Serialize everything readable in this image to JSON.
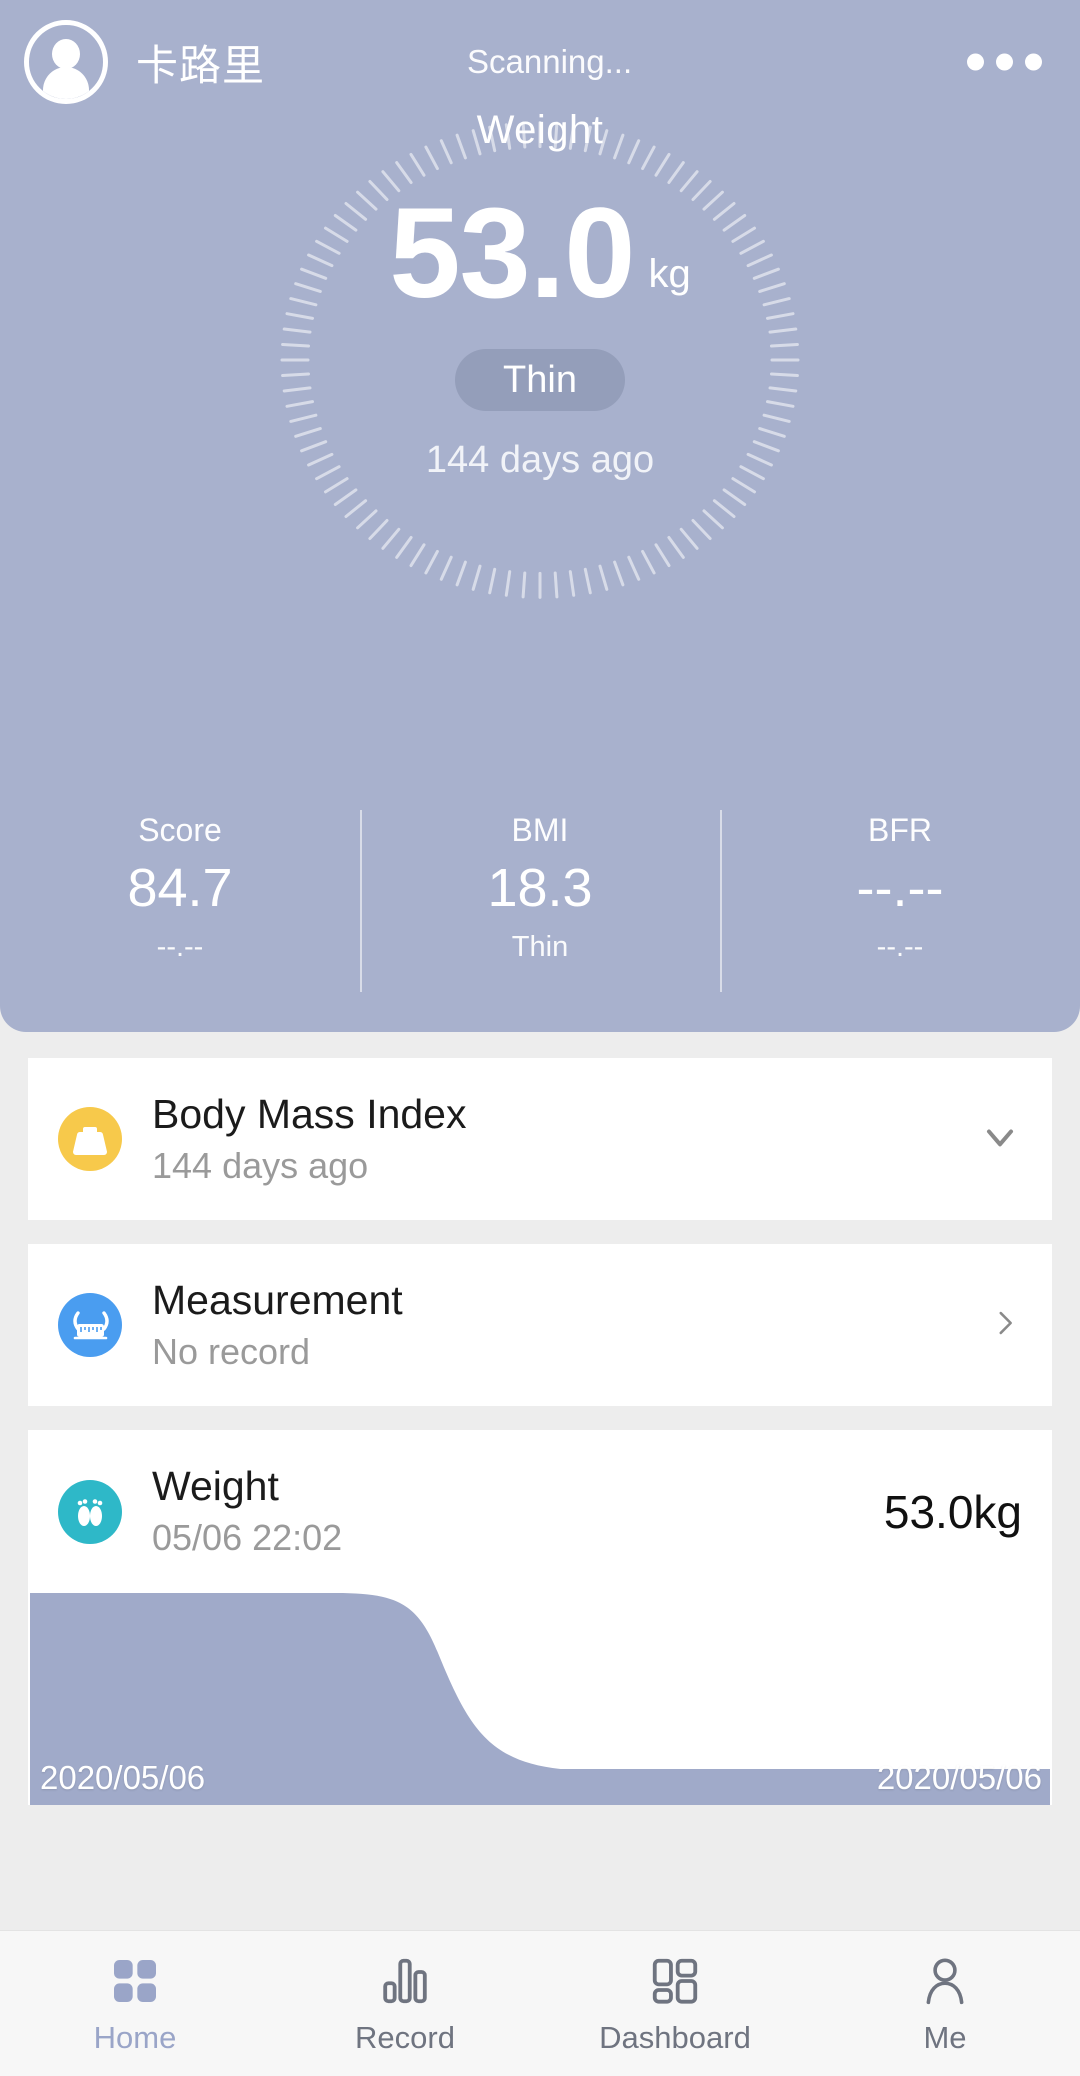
{
  "header": {
    "username": "卡路里",
    "status": "Scanning...",
    "avatar_icon": "user-avatar-icon",
    "menu_icon": "more-options-icon"
  },
  "hero": {
    "metric_label": "Weight",
    "value": "53.0",
    "unit": "kg",
    "badge": "Thin",
    "ago": "144 days ago",
    "background_color": "#a8b1cd",
    "badge_color": "#949eba"
  },
  "stats": [
    {
      "name": "Score",
      "value": "84.7",
      "sub": "--.--"
    },
    {
      "name": "BMI",
      "value": "18.3",
      "sub": "Thin"
    },
    {
      "name": "BFR",
      "value": "--.--",
      "sub": "--.--"
    }
  ],
  "cards": [
    {
      "title": "Body Mass Index",
      "subtitle": "144 days ago",
      "icon": "weight-scale-icon",
      "icon_color": "#f7c94b",
      "accessory": "chevron-down-icon"
    },
    {
      "title": "Measurement",
      "subtitle": "No record",
      "icon": "measuring-tape-icon",
      "icon_color": "#4a9df0",
      "accessory": "chevron-right-icon"
    },
    {
      "title": "Weight",
      "subtitle": "05/06 22:02",
      "value": "53.0kg",
      "icon": "footprints-icon",
      "icon_color": "#2eb8c8"
    }
  ],
  "chart_data": {
    "type": "area",
    "title": "Weight",
    "xlabel": "",
    "ylabel": "",
    "series": [
      {
        "name": "Weight",
        "values": [
          53.0,
          53.0,
          53.0,
          53.0
        ]
      }
    ],
    "x": [
      "2020/05/06",
      "2020/05/06",
      "2020/05/06",
      "2020/05/06"
    ],
    "x_start_label": "2020/05/06",
    "x_end_label": "2020/05/06",
    "fill_color": "#a0aac9",
    "grid": false,
    "legend": "none"
  },
  "tabbar": {
    "items": [
      {
        "label": "Home",
        "icon": "grid-squares-icon",
        "active": true
      },
      {
        "label": "Record",
        "icon": "bar-chart-icon",
        "active": false
      },
      {
        "label": "Dashboard",
        "icon": "dashboard-grid-icon",
        "active": false
      },
      {
        "label": "Me",
        "icon": "person-icon",
        "active": false
      }
    ],
    "active_color": "#9aa5c8",
    "inactive_color": "#6f7480"
  }
}
